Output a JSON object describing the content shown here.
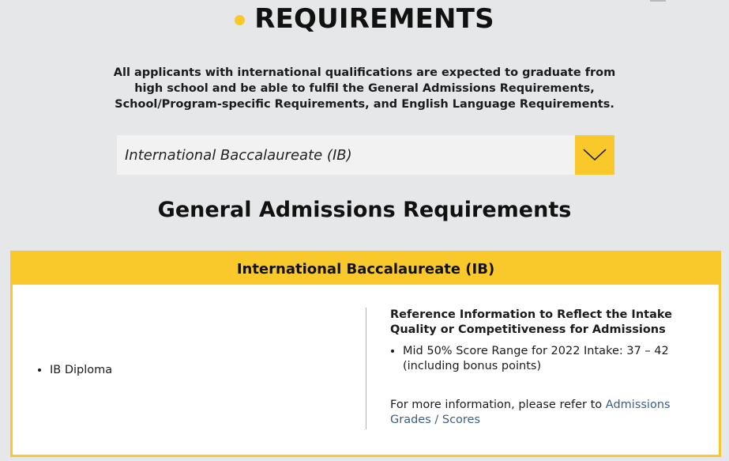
{
  "page": {
    "title": "REQUIREMENTS",
    "intro_text": "All applicants with international qualifications are expected to graduate from high school and be able to fulfil the General Admissions Requirements, School/Program-specific Requirements, and English Language Requirements."
  },
  "select": {
    "selected_value": "International Baccalaureate (IB)"
  },
  "section": {
    "heading": "General Admissions Requirements"
  },
  "card": {
    "header": "International Baccalaureate (IB)",
    "left_items": [
      "IB Diploma"
    ],
    "right": {
      "title": "Reference Information to Reflect the Intake Quality or Competitiveness for Admissions",
      "items": [
        "Mid 50% Score Range for 2022 Intake: 37 – 42 (including bonus points)"
      ],
      "more_info_prefix": "For more information, please refer to ",
      "more_info_link": "Admissions Grades / Scores"
    }
  },
  "colors": {
    "accent": "#f9c92b",
    "background": "#e6e7e8",
    "link": "#3a5d8a"
  },
  "icons": {
    "title_bullet": "dot-icon",
    "dropdown": "chevron-down-icon"
  }
}
